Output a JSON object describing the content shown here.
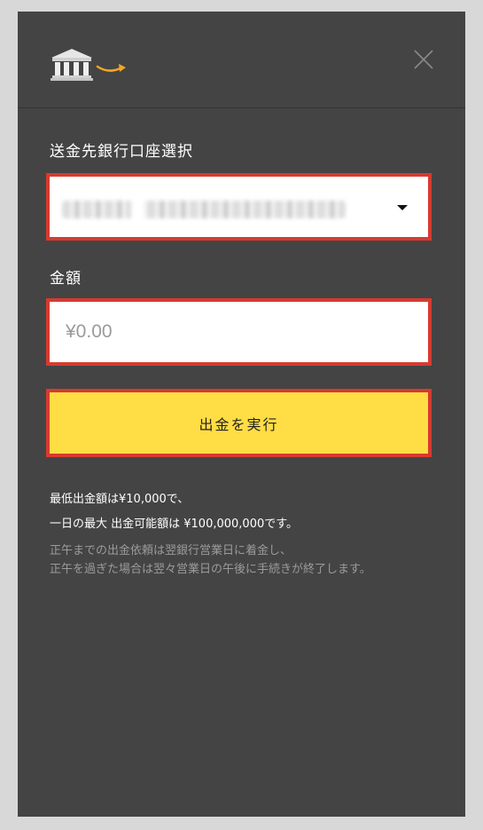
{
  "header": {
    "bank_icon": "bank-building-icon",
    "close_icon": "close-icon"
  },
  "form": {
    "bank_label": "送金先銀行口座選択",
    "bank_select": {
      "value": "(masked account)",
      "icon": "caret-down-icon"
    },
    "amount_label": "金額",
    "amount_placeholder": "¥0.00",
    "submit_label": "出金を実行"
  },
  "notes": {
    "line1": "最低出金額は¥10,000で、",
    "line2": "一日の最大 出金可能額は ¥100,000,000です。",
    "line3": "正午までの出金依頼は翌銀行営業日に着金し、",
    "line4": "正午を過ぎた場合は翌々営業日の午後に手続きが終了します。"
  },
  "colors": {
    "panel_bg": "#444444",
    "page_bg": "#d8d8d8",
    "highlight_border": "#d73a30",
    "button_yellow": "#ffdd44",
    "icon_orange": "#f5a623"
  }
}
